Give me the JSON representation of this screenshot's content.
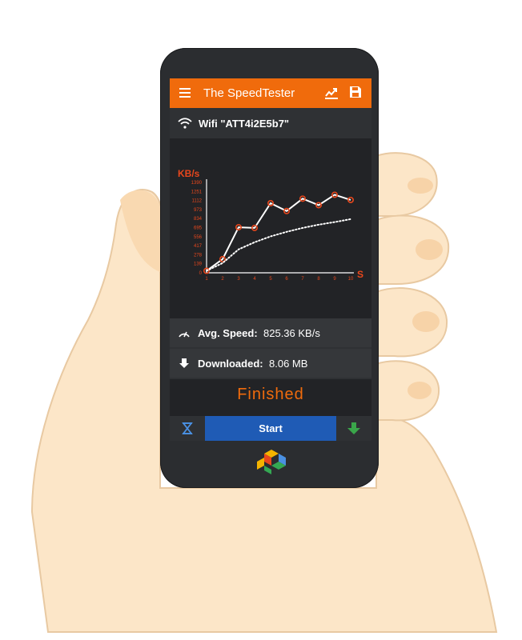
{
  "app": {
    "title": "The SpeedTester"
  },
  "icons": {
    "menu": "hamburger-menu-icon",
    "chart": "trending-chart-icon",
    "save": "floppy-disk-icon",
    "wifi": "wifi-icon",
    "speedometer": "speedometer-icon",
    "download": "download-arrow-icon",
    "timer": "hourglass-icon",
    "down_arrow": "green-down-arrow-icon",
    "logo": "app-cube-logo-icon"
  },
  "connection": {
    "label": "Wifi \"ATT4i2E5b7\""
  },
  "chart_data": {
    "type": "line",
    "ylabel": "KB/s",
    "xlabel": "S",
    "y_ticks": [
      "0",
      "139",
      "278",
      "417",
      "556",
      "695",
      "834",
      "973",
      "1112",
      "1251",
      "1390"
    ],
    "x_ticks": [
      "1",
      "2",
      "3",
      "4",
      "5",
      "6",
      "7",
      "8",
      "9",
      "10"
    ],
    "ylim": [
      0,
      1390
    ],
    "xlim": [
      1,
      10
    ],
    "series": [
      {
        "style": "solid-with-markers",
        "color": "#ffffff",
        "marker_color": "#e8471c",
        "x": [
          1,
          2,
          3,
          4,
          5,
          6,
          7,
          8,
          9,
          10
        ],
        "values": [
          30,
          210,
          700,
          690,
          1070,
          950,
          1140,
          1040,
          1200,
          1120
        ]
      },
      {
        "style": "dotted",
        "color": "#ffffff",
        "x": [
          1,
          2,
          3,
          4,
          5,
          6,
          7,
          8,
          9,
          10
        ],
        "values": [
          30,
          150,
          360,
          470,
          560,
          630,
          690,
          740,
          780,
          825
        ]
      }
    ],
    "grid": false
  },
  "stats": {
    "avg_label": "Avg. Speed:",
    "avg_value": "825.36 KB/s",
    "downloaded_label": "Downloaded:",
    "downloaded_value": "8.06 MB"
  },
  "status": {
    "text": "Finished"
  },
  "controls": {
    "start_label": "Start"
  },
  "colors": {
    "accent": "#f06b0c",
    "start_button": "#1f5bb5",
    "download_arrow": "#3aa64a",
    "timer_icon": "#4a90e2"
  }
}
